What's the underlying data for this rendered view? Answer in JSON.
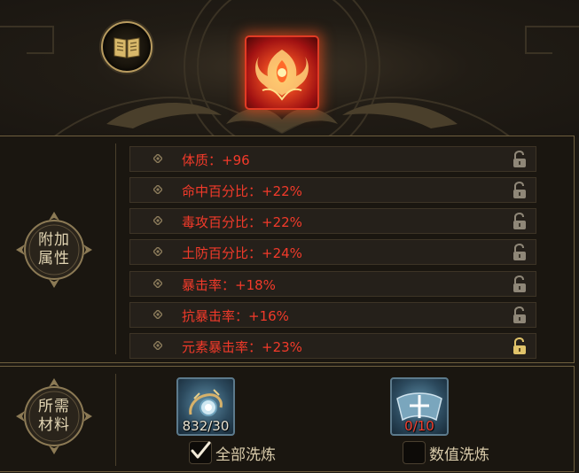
{
  "header": {
    "book_icon": "codex-book-icon",
    "item_icon": "phoenix-artifact-icon"
  },
  "attributes_panel": {
    "label": [
      "附加",
      "属性"
    ],
    "rows": [
      {
        "text": "体质：+96",
        "locked": false
      },
      {
        "text": "命中百分比：+22%",
        "locked": false
      },
      {
        "text": "毒攻百分比：+22%",
        "locked": false
      },
      {
        "text": "土防百分比：+24%",
        "locked": false
      },
      {
        "text": "暴击率：+18%",
        "locked": false
      },
      {
        "text": "抗暴击率：+16%",
        "locked": false
      },
      {
        "text": "元素暴击率：+23%",
        "locked": false,
        "highlighted": true
      }
    ]
  },
  "materials_panel": {
    "label": [
      "所需",
      "材料"
    ],
    "items": [
      {
        "icon": "refining-stone-icon",
        "count": "832/30"
      },
      {
        "icon": "value-scroll-icon",
        "count": "0/10"
      }
    ],
    "options": [
      {
        "label": "全部洗炼",
        "checked": true
      },
      {
        "label": "数值洗炼",
        "checked": false
      }
    ]
  },
  "colors": {
    "attribute_text": "#f23a2a",
    "gold_border": "#b89b5f",
    "panel_bg": "#1a1610"
  }
}
